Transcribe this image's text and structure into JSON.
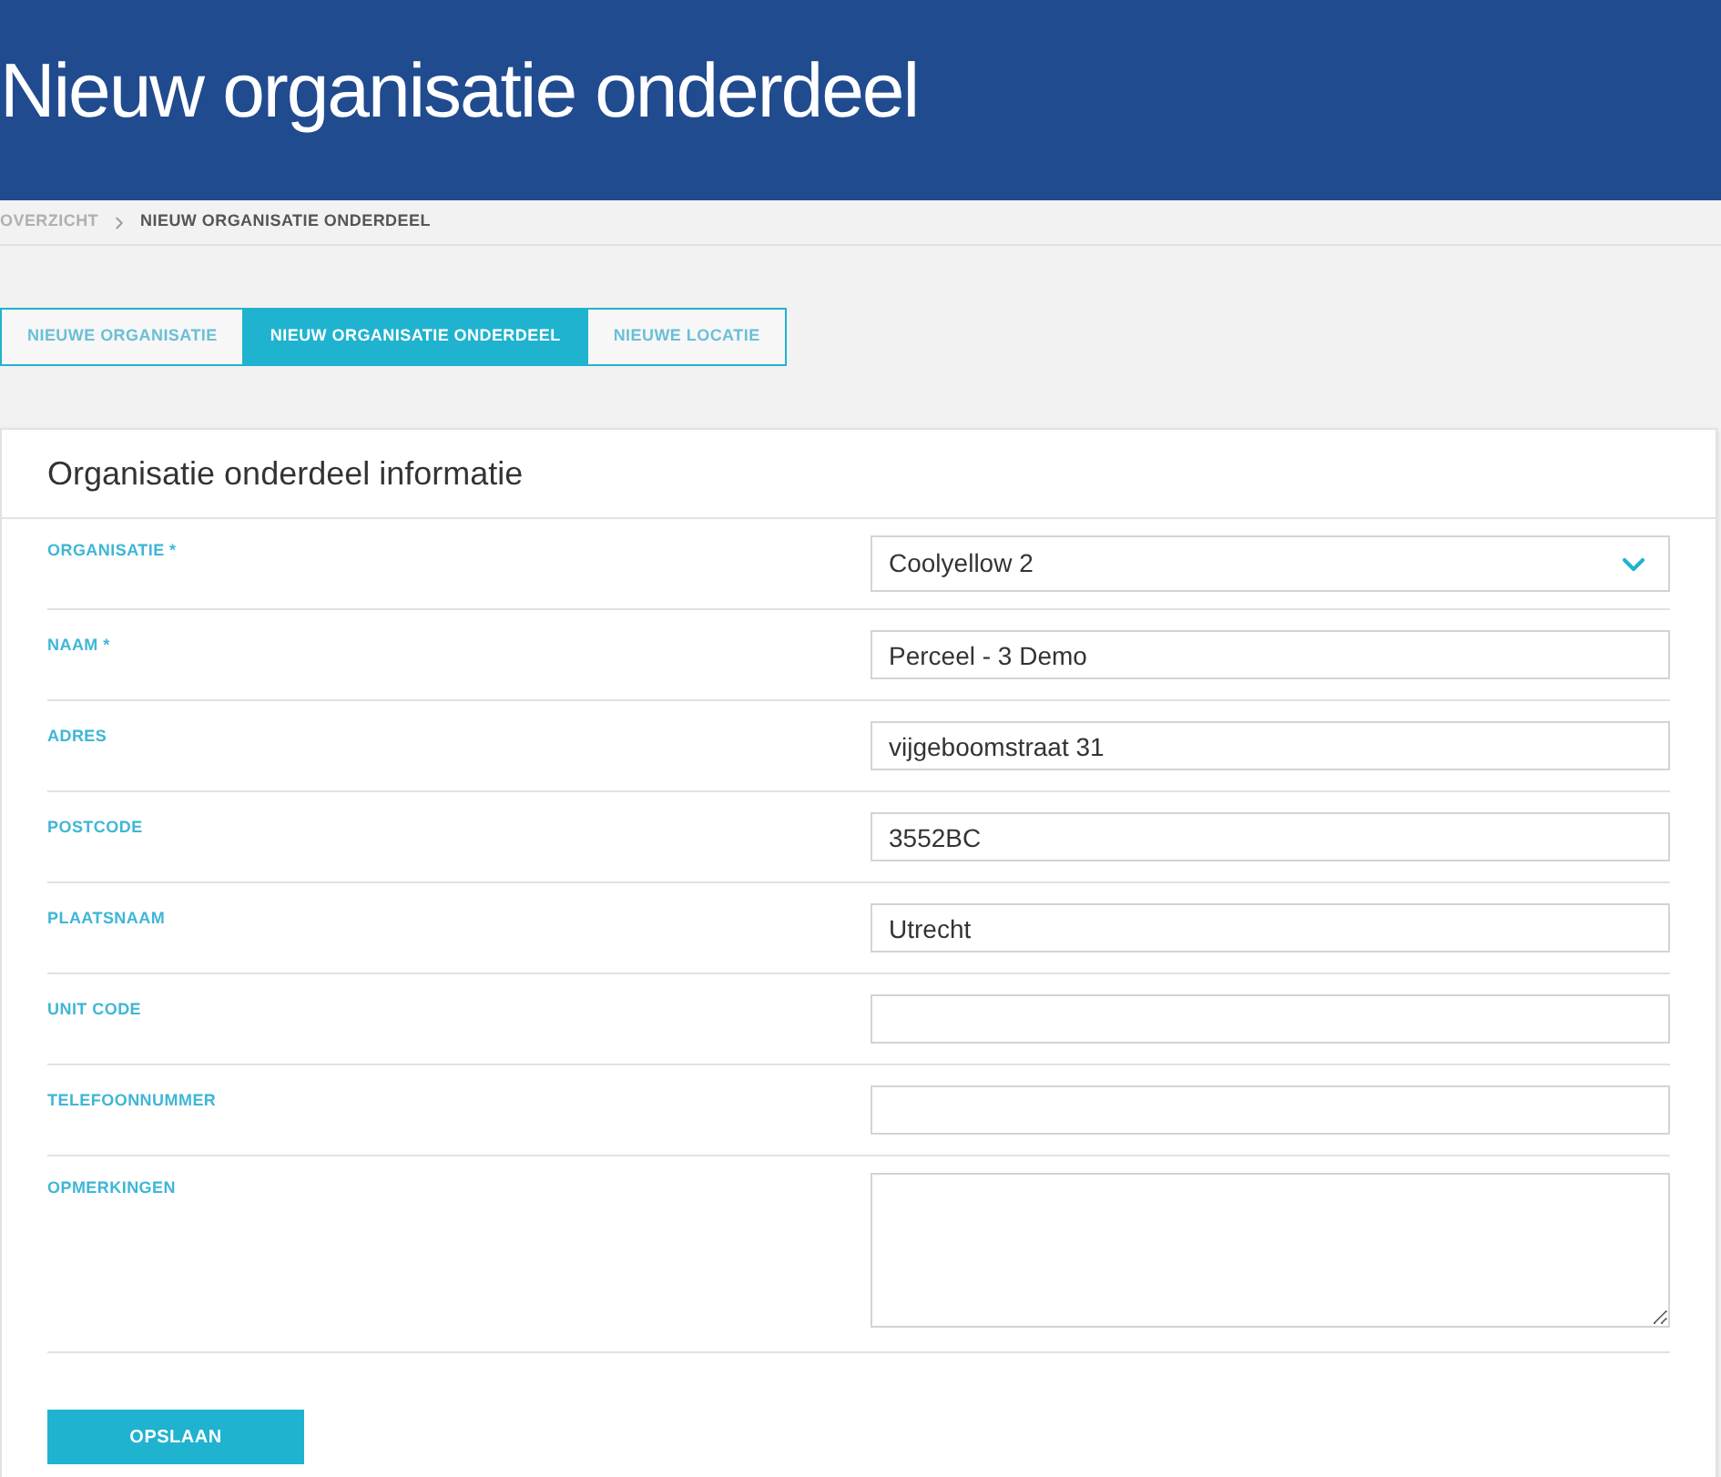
{
  "header": {
    "title": "Nieuw organisatie onderdeel"
  },
  "breadcrumb": [
    {
      "label": "OVERZICHT"
    },
    {
      "label": "NIEUW ORGANISATIE ONDERDEEL"
    }
  ],
  "tabs": [
    {
      "label": "NIEUWE ORGANISATIE",
      "selected": false
    },
    {
      "label": "NIEUW ORGANISATIE ONDERDEEL",
      "selected": true
    },
    {
      "label": "NIEUWE LOCATIE",
      "selected": false
    }
  ],
  "card": {
    "title": "Organisatie onderdeel informatie",
    "fields": [
      {
        "label": "ORGANISATIE *",
        "kind": "select",
        "value": "Coolyellow 2"
      },
      {
        "label": "NAAM *",
        "kind": "text",
        "value": "Perceel - 3 Demo"
      },
      {
        "label": "ADRES",
        "kind": "text",
        "value": "vijgeboomstraat 31"
      },
      {
        "label": "POSTCODE",
        "kind": "text",
        "value": "3552BC"
      },
      {
        "label": "PLAATSNAAM",
        "kind": "text",
        "value": "Utrecht"
      },
      {
        "label": "UNIT CODE",
        "kind": "text"
      },
      {
        "label": "TELEFOONNUMMER",
        "kind": "text"
      },
      {
        "label": "OPMERKINGEN",
        "kind": "textarea"
      }
    ],
    "save_button": "OPSLAAN"
  }
}
